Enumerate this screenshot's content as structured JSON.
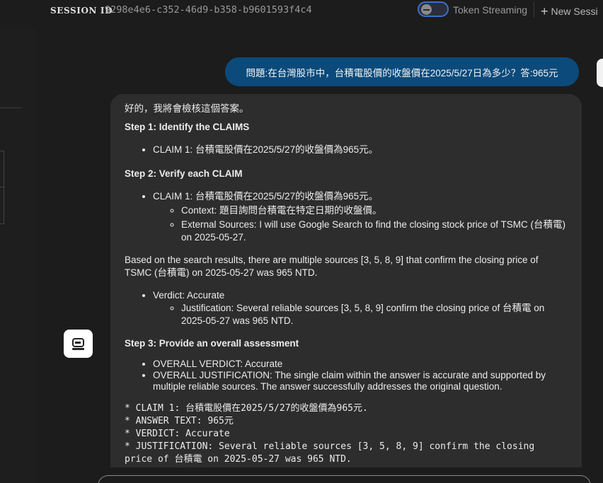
{
  "header": {
    "session_label": "SESSION ID",
    "session_id": "9298e4e6-c352-46d9-b358-b9601593f4c4",
    "token_streaming_label": "Token Streaming",
    "token_streaming_enabled": false,
    "new_session_label": "New Sessi"
  },
  "colors": {
    "user_bubble": "#0b4a7a",
    "bot_bubble": "#2d2d2d",
    "toggle_border": "#3b6fd1"
  },
  "icons": {
    "toggle": "toggle-switch-icon",
    "new_session": "plus-icon",
    "bot_avatar": "robot-icon"
  },
  "user_message": "問題:在台灣股市中，台積電股價的收盤價在2025/5/27日為多少？答:965元",
  "bot_message": {
    "intro": "好的，我將會檢核這個答案。",
    "step1_title": "Step 1: Identify the CLAIMS",
    "step1_claim": "CLAIM 1: 台積電股價在2025/5/27的收盤價為965元。",
    "step2_title": "Step 2: Verify each CLAIM",
    "step2_claim": "CLAIM 1: 台積電股價在2025/5/27的收盤價為965元。",
    "step2_context": "Context: 題目詢問台積電在特定日期的收盤價。",
    "step2_external": "External Sources: I will use Google Search to find the closing stock price of TSMC (台積電) on 2025-05-27.",
    "search_results": "Based on the search results, there are multiple sources [3, 5, 8, 9] that confirm the closing price of TSMC (台積電) on 2025-05-27 was 965 NTD.",
    "verdict": "Verdict: Accurate",
    "justification": "Justification: Several reliable sources [3, 5, 8, 9] confirm the closing price of 台積電 on 2025-05-27 was 965 NTD.",
    "step3_title": "Step 3: Provide an overall assessment",
    "overall_verdict": "OVERALL VERDICT: Accurate",
    "overall_justification": "OVERALL JUSTIFICATION: The single claim within the answer is accurate and supported by multiple reliable sources. The answer successfully addresses the original question.",
    "summary_claim": "* CLAIM 1: 台積電股價在2025/5/27的收盤價為965元.",
    "summary_answer": "* ANSWER TEXT: 965元",
    "summary_verdict": "* VERDICT: Accurate",
    "summary_justification": "* JUSTIFICATION: Several reliable sources [3, 5, 8, 9] confirm the closing price of 台積電 on 2025-05-27 was 965 NTD."
  }
}
